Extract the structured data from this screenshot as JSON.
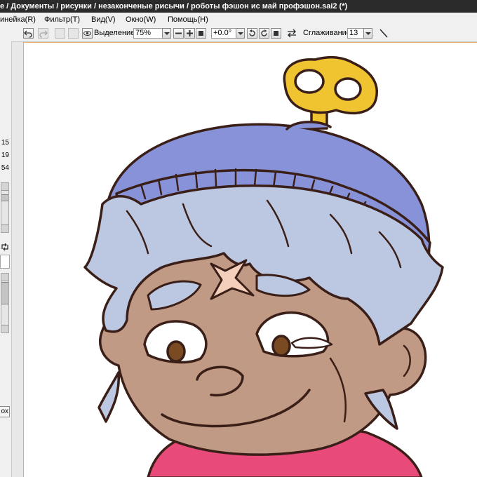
{
  "window": {
    "title": "е / Документы / рисунки / незаконченые рисычи / роботы фэшон ис май профэшон.sai2 (*)"
  },
  "menu": {
    "items": [
      {
        "label": "инейка(R)"
      },
      {
        "label": "Фильтр(T)"
      },
      {
        "label": "Вид(V)"
      },
      {
        "label": "Окно(W)"
      },
      {
        "label": "Помощь(H)"
      }
    ]
  },
  "toolbar": {
    "selection_label": "Выделение",
    "zoom_value": "75%",
    "rotation_value": "+0.0°",
    "smoothing_label": "Сглаживание",
    "smoothing_value": "13"
  },
  "left_panel": {
    "values": [
      "15",
      "19",
      "54"
    ],
    "box_label": "ox"
  },
  "colors": {
    "titlebar": "#2b2b2b",
    "canvas_border": "#e2b06a",
    "hat_blue": "#8792d8",
    "hair_blue": "#bcc8e2",
    "skin": "#c09a84",
    "outline": "#3a1f18",
    "key_gold": "#f0c330",
    "scarf_pink": "#e84a7a"
  },
  "icons": {
    "undo": "undo-icon",
    "redo": "redo-icon",
    "eye": "eye-icon",
    "minus": "minus-icon",
    "plus": "plus-icon",
    "flip": "flip-icon",
    "pen": "pen-icon"
  }
}
